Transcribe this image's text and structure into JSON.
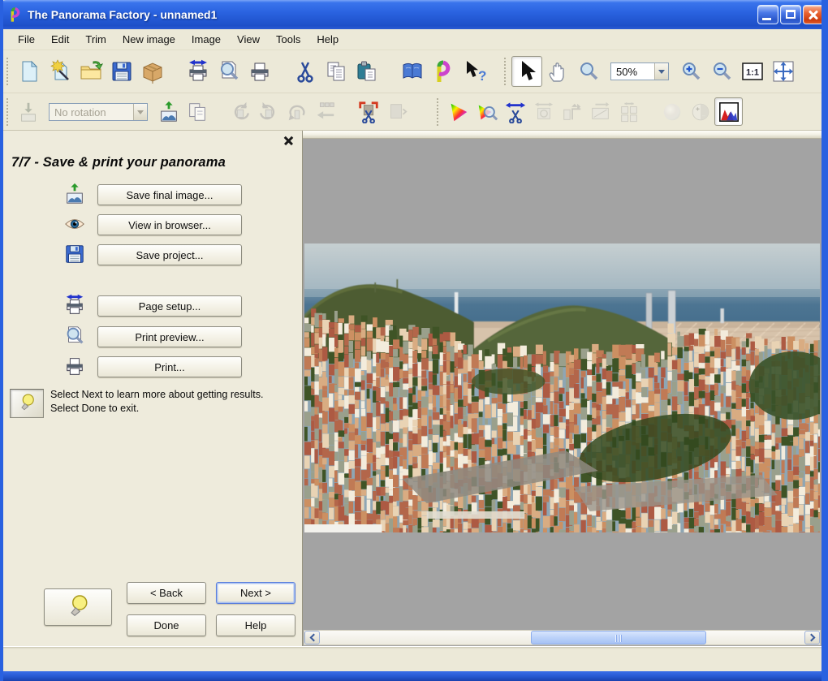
{
  "window": {
    "title": "The Panorama Factory - unnamed1",
    "controls": {
      "minimize": "minimize",
      "maximize": "maximize",
      "close": "close"
    }
  },
  "menu_bar": {
    "items": [
      "File",
      "Edit",
      "Trim",
      "New image",
      "Image",
      "View",
      "Tools",
      "Help"
    ]
  },
  "toolbars_row1": [
    {
      "name": "standard-toolbar",
      "items": [
        {
          "icon": "new-document-icon"
        },
        {
          "icon": "new-wizard-icon"
        },
        {
          "icon": "open-folder-icon"
        },
        {
          "icon": "save-icon"
        },
        {
          "icon": "package-icon"
        },
        {
          "icon": "page-setup-icon",
          "gap": true
        },
        {
          "icon": "print-preview-icon"
        },
        {
          "icon": "print-icon"
        },
        {
          "icon": "cut-icon",
          "gap": true
        },
        {
          "icon": "copy-icon"
        },
        {
          "icon": "paste-icon"
        },
        {
          "icon": "help-book-icon",
          "gap": true
        },
        {
          "icon": "about-icon"
        },
        {
          "icon": "context-help-icon"
        }
      ]
    },
    {
      "name": "view-toolbar",
      "items": [
        {
          "icon": "select-arrow-icon",
          "pressed": true
        },
        {
          "icon": "hand-pan-icon"
        },
        {
          "icon": "zoom-tool-icon"
        },
        {
          "type": "combo",
          "name": "zoom-level-combo",
          "value": "50%",
          "width": 72
        },
        {
          "icon": "zoom-in-icon"
        },
        {
          "icon": "zoom-out-icon"
        },
        {
          "icon": "actual-size-icon",
          "text": "1:1"
        },
        {
          "icon": "fit-window-icon"
        }
      ]
    }
  ],
  "toolbars_row2": [
    {
      "name": "image-toolbar",
      "items": [
        {
          "icon": "import-images-icon",
          "disabled": true
        },
        {
          "type": "combo",
          "name": "rotation-combo",
          "value": "No rotation",
          "width": 122,
          "disabled": true
        },
        {
          "icon": "export-image-icon"
        },
        {
          "icon": "duplicate-icon"
        },
        {
          "icon": "rotate-left-icon",
          "disabled": true,
          "gap": true
        },
        {
          "icon": "rotate-right-icon",
          "disabled": true
        },
        {
          "icon": "rotate-180-icon",
          "disabled": true
        },
        {
          "icon": "stitch-icon",
          "disabled": true
        },
        {
          "icon": "crop-icon",
          "gap": true
        },
        {
          "icon": "crop-alt-icon",
          "disabled": true
        }
      ]
    },
    {
      "name": "color-toolbar",
      "items": [
        {
          "icon": "color-gamut-icon"
        },
        {
          "icon": "gamut-inspect-icon"
        },
        {
          "icon": "trim-icon"
        },
        {
          "icon": "fine-tune-icon",
          "disabled": true
        },
        {
          "icon": "resize-icon",
          "disabled": true
        },
        {
          "icon": "layout-icon",
          "disabled": true
        },
        {
          "icon": "tile-icon",
          "disabled": true
        },
        {
          "icon": "sphere-icon",
          "disabled": true,
          "gap": true
        },
        {
          "icon": "contrast-icon",
          "disabled": true
        },
        {
          "icon": "histogram-icon",
          "pressed": true
        }
      ]
    }
  ],
  "wizard": {
    "step_title": "7/7 - Save & print your panorama",
    "groups": [
      {
        "rows": [
          {
            "name": "save-final-image-button",
            "icon": "export-image-icon",
            "label": "Save final image..."
          },
          {
            "name": "view-in-browser-button",
            "icon": "eye-icon",
            "label": "View in browser..."
          },
          {
            "name": "save-project-button",
            "icon": "save-icon",
            "label": "Save project..."
          }
        ]
      },
      {
        "rows": [
          {
            "name": "page-setup-button",
            "icon": "page-setup-icon",
            "label": "Page setup..."
          },
          {
            "name": "print-preview-button",
            "icon": "print-preview-icon",
            "label": "Print preview..."
          },
          {
            "name": "print-button",
            "icon": "print-icon",
            "label": "Print..."
          }
        ]
      }
    ],
    "tip": {
      "icon": "lightbulb-icon",
      "line1": "Select Next to learn more about getting results.",
      "line2": "Select Done to exit."
    },
    "nav": {
      "back": "< Back",
      "next": "Next >",
      "done": "Done",
      "help": "Help"
    }
  },
  "view_area": {
    "zoom_value": "50%",
    "scrollbar": {
      "orientation": "horizontal",
      "thumb_left_pct": 44,
      "thumb_width_pct": 34
    }
  },
  "colors": {
    "titlebar_blue": "#2a63e0",
    "chrome_beige": "#ece9d8",
    "canvas_gray": "#a3a3a3",
    "scroll_thumb_blue": "#bcd2f9"
  }
}
